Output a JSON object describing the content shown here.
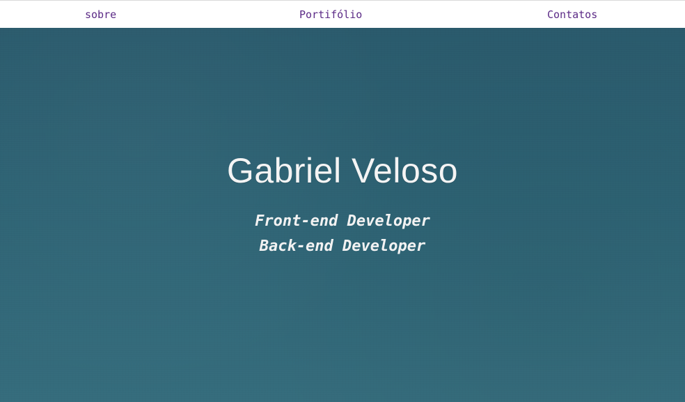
{
  "nav": {
    "items": [
      {
        "label": "sobre"
      },
      {
        "label": "Portifólio"
      },
      {
        "label": "Contatos"
      }
    ],
    "link_color": "#5b2a86"
  },
  "hero": {
    "name": "Gabriel Veloso",
    "roles": [
      "Front-end Developer",
      "Back-end Developer"
    ],
    "background_color": "#2d6273",
    "text_color": "#f4f4f4"
  }
}
